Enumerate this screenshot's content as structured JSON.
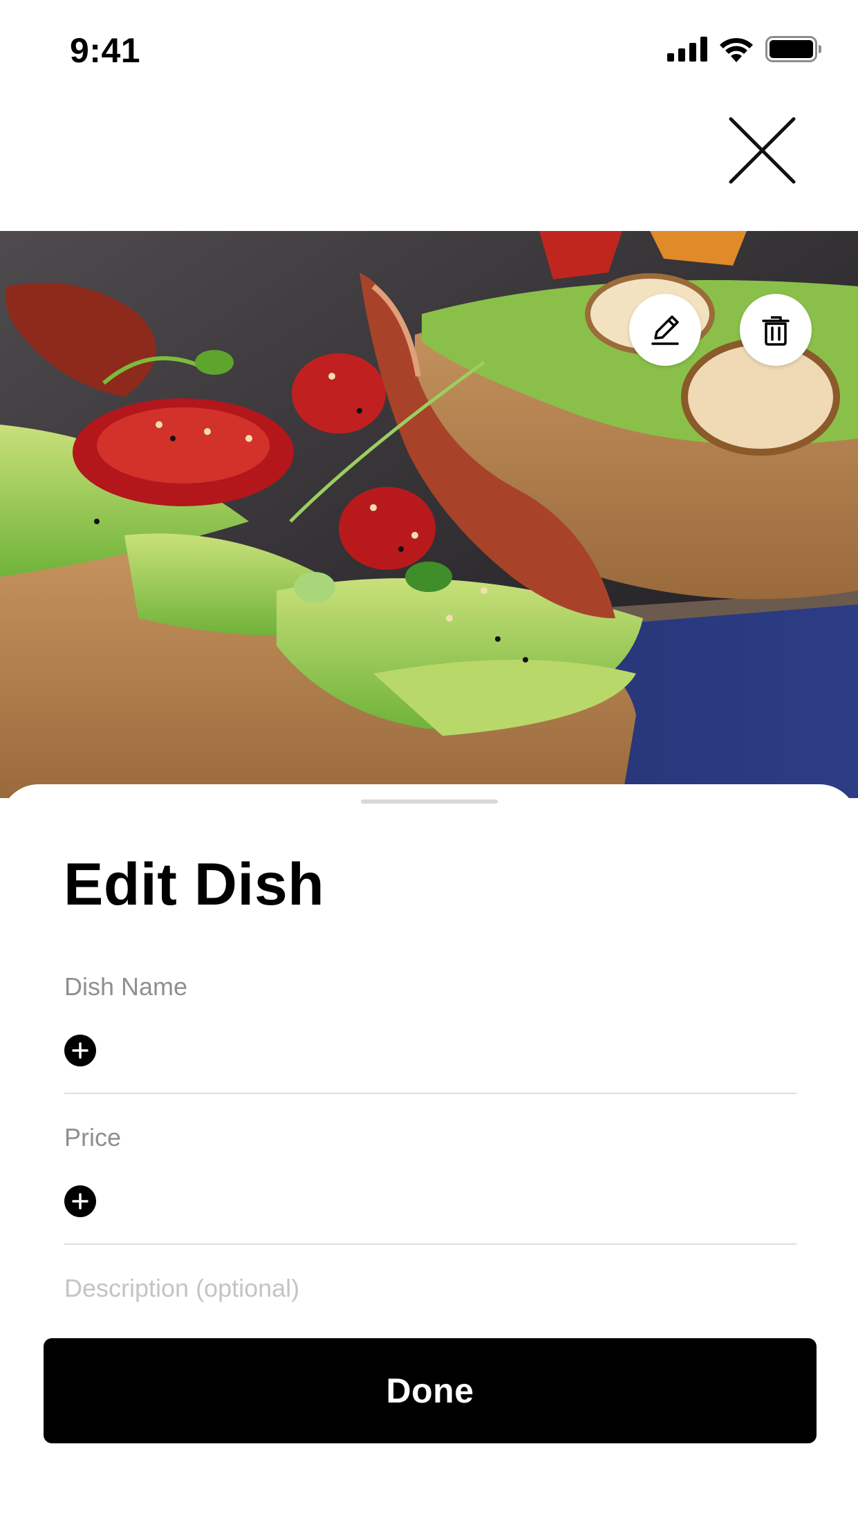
{
  "status_bar": {
    "time": "9:41",
    "icons": [
      "cellular-signal-icon",
      "wifi-icon",
      "battery-icon"
    ]
  },
  "header": {
    "close_icon": "close-icon"
  },
  "photo": {
    "edit_icon": "pencil-icon",
    "delete_icon": "trash-icon"
  },
  "sheet": {
    "title": "Edit Dish",
    "fields": [
      {
        "label": "Dish Name",
        "add_icon": "plus-circle-icon"
      },
      {
        "label": "Price",
        "add_icon": "plus-circle-icon"
      },
      {
        "label": "Description (optional)"
      }
    ],
    "done_label": "Done"
  },
  "colors": {
    "primary": "#000000",
    "label": "#8f8f8f",
    "divider": "#dedede",
    "background": "#ffffff"
  }
}
